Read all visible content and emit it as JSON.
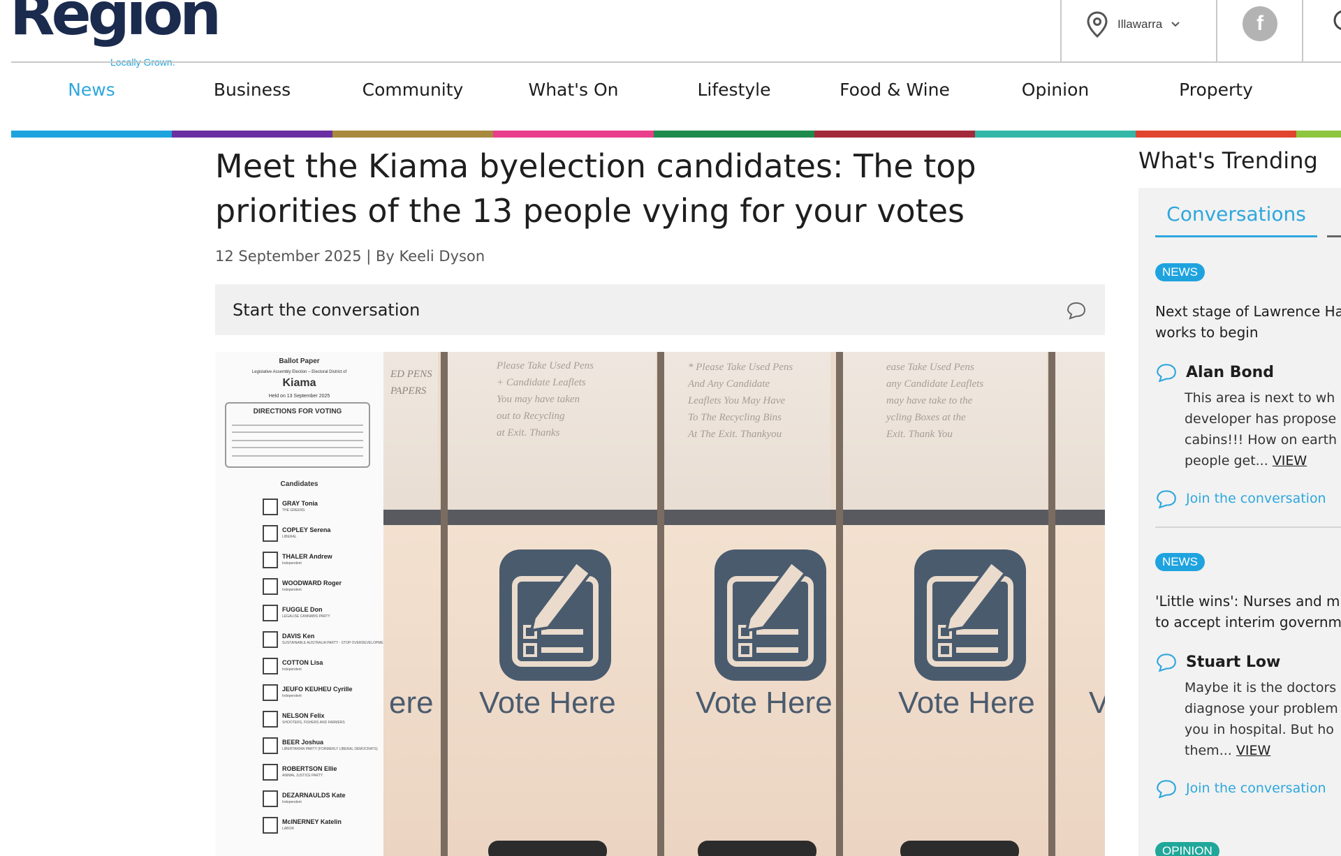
{
  "header": {
    "logo_text": "Region",
    "logo_tagline": "Locally Grown.",
    "location": "Illawarra",
    "facebook_letter": "f"
  },
  "nav": {
    "items": [
      {
        "label": "News",
        "active": true,
        "color": "#1fa3df"
      },
      {
        "label": "Business",
        "active": false,
        "color": "#6a2fa0"
      },
      {
        "label": "Community",
        "active": false,
        "color": "#a8893d"
      },
      {
        "label": "What's On",
        "active": false,
        "color": "#e83e8c"
      },
      {
        "label": "Lifestyle",
        "active": false,
        "color": "#1e8a4c"
      },
      {
        "label": "Food & Wine",
        "active": false,
        "color": "#a32a3a"
      },
      {
        "label": "Opinion",
        "active": false,
        "color": "#33b8a8"
      },
      {
        "label": "Property",
        "active": false,
        "color": "#e0452f"
      }
    ],
    "extra_color": "#8dc63f",
    "active_color": "#2ea7dd"
  },
  "article": {
    "title": "Meet the Kiama byelection candidates: The top priorities of the 13 people vying for your votes",
    "byline": "12 September 2025 | By Keeli Dyson",
    "conversation_label": "Start the conversation"
  },
  "ballot": {
    "heading": "Ballot Paper",
    "subheading": "Legislative Assembly Election – Electoral District of",
    "district": "Kiama",
    "held_on": "Held on 13 September 2025",
    "directions_title": "DIRECTIONS FOR VOTING",
    "candidates_label": "Candidates",
    "candidates": [
      {
        "name": "GRAY Tonia",
        "party": "THE GREENS"
      },
      {
        "name": "COPLEY Serena",
        "party": "LIBERAL"
      },
      {
        "name": "THALER Andrew",
        "party": "Independent"
      },
      {
        "name": "WOODWARD Roger",
        "party": "Independent"
      },
      {
        "name": "FUGGLE Don",
        "party": "LEGALISE CANNABIS PARTY"
      },
      {
        "name": "DAVIS Ken",
        "party": "SUSTAINABLE AUSTRALIA PARTY - STOP OVERDEVELOPMENT / CORRUPTION"
      },
      {
        "name": "COTTON Lisa",
        "party": "Independent"
      },
      {
        "name": "JEUFO KEUHEU Cyrille",
        "party": "Independent"
      },
      {
        "name": "NELSON Felix",
        "party": "SHOOTERS, FISHERS AND FARMERS"
      },
      {
        "name": "BEER Joshua",
        "party": "LIBERTARIAN PARTY (FORMERLY LIBERAL DEMOCRATS)"
      },
      {
        "name": "ROBERTSON Ellie",
        "party": "ANIMAL JUSTICE PARTY"
      },
      {
        "name": "DEZARNAULDS Kate",
        "party": "Independent"
      },
      {
        "name": "McINERNEY Katelin",
        "party": "LABOR"
      }
    ]
  },
  "photo": {
    "box_label": "Vote Here",
    "partial_left": "ere",
    "partial_right": "V",
    "note_1": "Please Take Used Pens\n+ Candidate Leaflets\nYou may have taken\nout to Recycling\nat Exit. Thanks",
    "note_2": "* Please Take Used Pens\nAnd Any Candidate\nLeaflets You May Have\nTo The Recycling Bins\nAt The Exit. Thankyou",
    "note_3": "ease Take Used Pens\nany Candidate Leaflets\nmay have take to the\nycling Boxes at the\nExit. Thank You",
    "note_4": "ED PENS\nPAPERS"
  },
  "sidebar": {
    "heading": "What's Trending",
    "tab": "Conversations",
    "items": [
      {
        "badge": "NEWS",
        "title_line1": "Next stage of Lawrence Ha",
        "title_line2": "works to begin",
        "user": "Alan Bond",
        "comment_lines": [
          "This area is next to wh",
          "developer has propose",
          "cabins!!! How on earth",
          "people get..."
        ],
        "view": "VIEW",
        "join": "Join the conversation"
      },
      {
        "badge": "NEWS",
        "title_line1": "'Little wins': Nurses and mid",
        "title_line2": "to accept interim governm",
        "user": "Stuart Low",
        "comment_lines": [
          "Maybe it is the doctors",
          "diagnose your problem",
          "you in hospital. But ho",
          "them..."
        ],
        "view": "VIEW",
        "join": "Join the conversation"
      },
      {
        "badge": "OPINION"
      }
    ]
  },
  "colors": {
    "brand_navy": "#1b2b4e",
    "accent_blue": "#2ea7dd",
    "badge_blue": "#1fa3df",
    "badge_teal": "#1fa79a",
    "booth_grey": "#4a5b6e"
  }
}
